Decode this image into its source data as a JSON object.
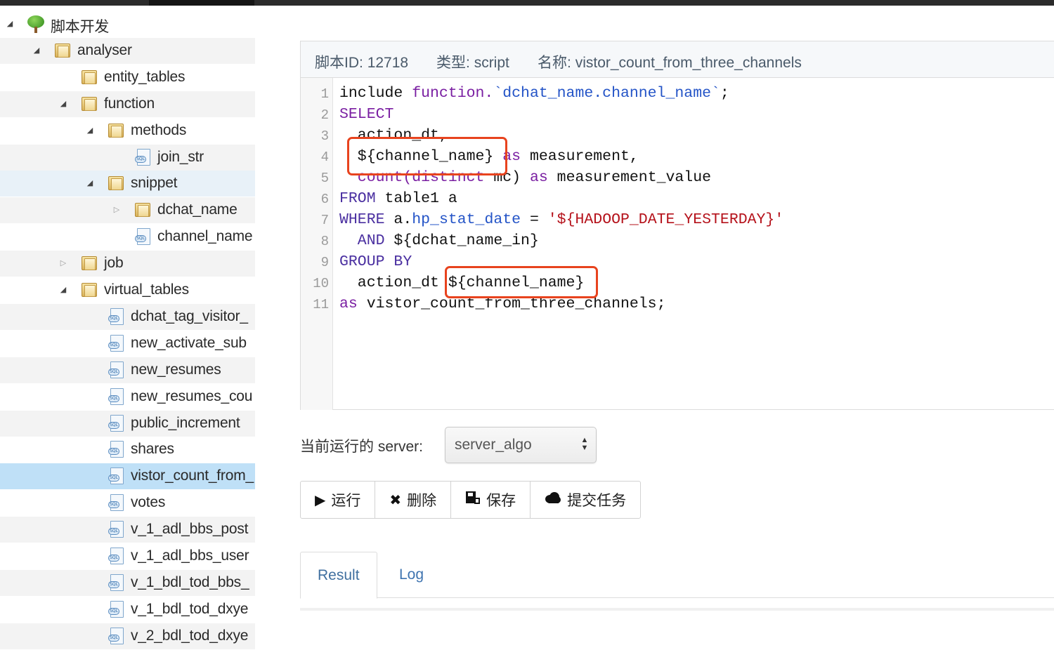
{
  "sidebar": {
    "items": [
      {
        "label": "脚本开发",
        "type": "root",
        "toggle": "open"
      },
      {
        "label": "analyser",
        "type": "folder",
        "toggle": "open"
      },
      {
        "label": "entity_tables",
        "type": "folder",
        "toggle": "none"
      },
      {
        "label": "function",
        "type": "folder",
        "toggle": "open"
      },
      {
        "label": "methods",
        "type": "folder",
        "toggle": "open"
      },
      {
        "label": "join_str",
        "type": "file",
        "toggle": "none"
      },
      {
        "label": "snippet",
        "type": "folder",
        "toggle": "open"
      },
      {
        "label": "dchat_name",
        "type": "folder",
        "toggle": "closed"
      },
      {
        "label": "channel_name",
        "type": "file",
        "toggle": "none"
      },
      {
        "label": "job",
        "type": "folder",
        "toggle": "closed"
      },
      {
        "label": "virtual_tables",
        "type": "folder",
        "toggle": "open"
      },
      {
        "label": "dchat_tag_visitor_",
        "type": "file",
        "toggle": "none"
      },
      {
        "label": "new_activate_sub",
        "type": "file",
        "toggle": "none"
      },
      {
        "label": "new_resumes",
        "type": "file",
        "toggle": "none"
      },
      {
        "label": "new_resumes_cou",
        "type": "file",
        "toggle": "none"
      },
      {
        "label": "public_increment",
        "type": "file",
        "toggle": "none"
      },
      {
        "label": "shares",
        "type": "file",
        "toggle": "none"
      },
      {
        "label": "vistor_count_from_",
        "type": "file",
        "toggle": "none"
      },
      {
        "label": "votes",
        "type": "file",
        "toggle": "none"
      },
      {
        "label": "v_1_adl_bbs_post",
        "type": "file",
        "toggle": "none"
      },
      {
        "label": "v_1_adl_bbs_user",
        "type": "file",
        "toggle": "none"
      },
      {
        "label": "v_1_bdl_tod_bbs_",
        "type": "file",
        "toggle": "none"
      },
      {
        "label": "v_1_bdl_tod_dxye",
        "type": "file",
        "toggle": "none"
      },
      {
        "label": "v_2_bdl_tod_dxye",
        "type": "file",
        "toggle": "none"
      }
    ],
    "selected_index": 17,
    "sql_tag": "SQL"
  },
  "editor": {
    "header": {
      "id_label": "脚本ID:",
      "id_value": "12718",
      "type_label": "类型:",
      "type_value": "script",
      "name_label": "名称:",
      "name_value": "vistor_count_from_three_channels"
    },
    "line_numbers": [
      "1",
      "2",
      "3",
      "4",
      "5",
      "6",
      "7",
      "8",
      "9",
      "10",
      "11"
    ],
    "lines": {
      "l1": {
        "a": "include ",
        "b": "function.",
        "c": "`dchat_name.channel_name`",
        "d": ";"
      },
      "l2": {
        "a": "SELECT"
      },
      "l3": {
        "a": "  action_dt,"
      },
      "l4": {
        "a": "  ${channel_name} ",
        "b": "as",
        "c": " measurement,"
      },
      "l5": {
        "a": "  count(distinct",
        "b": " mc) ",
        "c": "as",
        "d": " measurement_value"
      },
      "l6": {
        "a": "FROM",
        "b": " table1 a"
      },
      "l7": {
        "a": "WHERE",
        "b": " a.",
        "c": "hp_stat_date",
        "d": " = ",
        "e": "'${HADOOP_DATE_YESTERDAY}'"
      },
      "l8": {
        "a": "  AND",
        "b": " ${dchat_name_in}"
      },
      "l9": {
        "a": "GROUP BY"
      },
      "l10": {
        "a": "  action_dt ${channel_name}"
      },
      "l11": {
        "a": "as",
        "b": " vistor_count_from_three_channels;"
      }
    }
  },
  "server": {
    "label": "当前运行的 server:",
    "selected": "server_algo"
  },
  "toolbar": {
    "run": "运行",
    "delete": "删除",
    "save": "保存",
    "submit": "提交任务"
  },
  "tabs": {
    "result": "Result",
    "log": "Log"
  },
  "colors": {
    "accent_red": "#e8431e",
    "keyword": "#7a1fa2",
    "selection": "#bfe0f7",
    "link": "#3f74b0"
  }
}
